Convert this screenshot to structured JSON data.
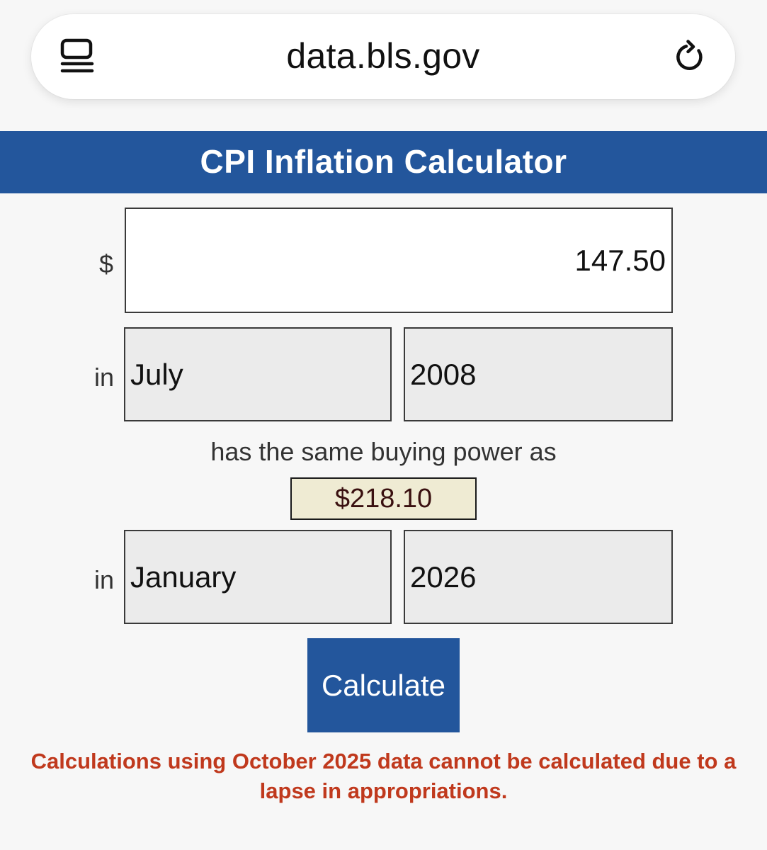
{
  "browser": {
    "url": "data.bls.gov",
    "reader_icon": "reader-mode-icon",
    "reload_icon": "reload-icon"
  },
  "header": {
    "title": "CPI Inflation Calculator"
  },
  "form": {
    "currency_symbol": "$",
    "amount_value": "147.50",
    "from_label": "in",
    "from_month": "July",
    "from_year": "2008",
    "middle_text": "has the same buying power as",
    "result": "$218.10",
    "to_label": "in",
    "to_month": "January",
    "to_year": "2026",
    "calculate_label": "Calculate"
  },
  "notice": {
    "line1": "Calculations using October 2025 data cannot be calculated due to a",
    "line2": "lapse in appropriations."
  },
  "colors": {
    "brand_blue": "#23569c",
    "notice_red": "#c0391d",
    "result_bg": "#efebd3",
    "select_bg": "#ebebeb"
  }
}
